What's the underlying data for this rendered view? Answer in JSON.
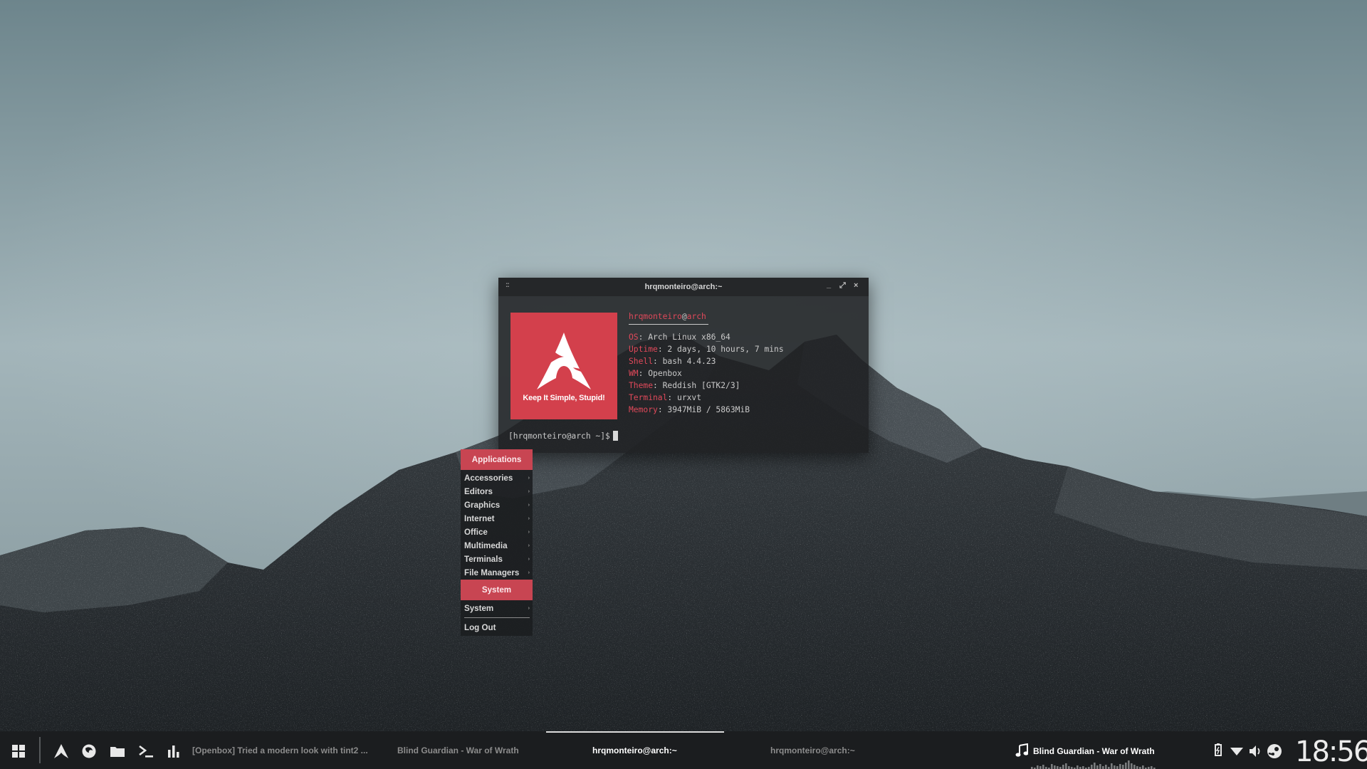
{
  "terminal": {
    "title": "hrqmonteiro@arch:~",
    "grip": "::",
    "minimize": "_",
    "maximize": "⤢",
    "close": "×",
    "logo_text": "Keep It Simple, Stupid!",
    "fetch": {
      "user": "hrqmonteiro",
      "at": "@",
      "host": "arch",
      "rows": [
        {
          "key": "OS",
          "value": ": Arch Linux x86_64"
        },
        {
          "key": "Uptime",
          "value": ": 2 days, 10 hours, 7 mins"
        },
        {
          "key": "Shell",
          "value": ": bash 4.4.23"
        },
        {
          "key": "WM",
          "value": ": Openbox"
        },
        {
          "key": "Theme",
          "value": ": Reddish [GTK2/3]"
        },
        {
          "key": "Terminal",
          "value": ": urxvt"
        },
        {
          "key": "Memory",
          "value": ": 3947MiB / 5863MiB"
        }
      ]
    },
    "prompt": "[hrqmonteiro@arch ~]$"
  },
  "menu": {
    "header": "Applications",
    "items": [
      {
        "label": "Accessories",
        "arrow": "›"
      },
      {
        "label": "Editors",
        "arrow": "›"
      },
      {
        "label": "Graphics",
        "arrow": "›"
      },
      {
        "label": "Internet",
        "arrow": "›"
      },
      {
        "label": "Office",
        "arrow": "›"
      },
      {
        "label": "Multimedia",
        "arrow": "›"
      },
      {
        "label": "Terminals",
        "arrow": "›"
      },
      {
        "label": "File Managers",
        "arrow": "›"
      }
    ],
    "system_header": "System",
    "system_item": "System",
    "system_arrow": "›",
    "logout": "Log Out"
  },
  "taskbar": {
    "tasks": [
      "[Openbox] Tried a modern look with tint2 ...",
      "Blind Guardian - War of Wrath",
      "hrqmonteiro@arch:~",
      "hrqmonteiro@arch:~"
    ],
    "active_task_index": 2,
    "now_playing": "Blind Guardian - War of Wrath",
    "clock": "18:56",
    "launchers": [
      "apps-grid-icon",
      "arch-logo-icon",
      "firefox-icon",
      "folder-icon",
      "terminal-icon",
      "stats-icon"
    ],
    "tray": [
      "battery-icon",
      "wifi-icon",
      "volume-icon",
      "steam-icon"
    ]
  },
  "colors": {
    "accent": "#d3404c",
    "menu_header": "#c84552",
    "taskbar_bg": "#1b1d1f"
  }
}
